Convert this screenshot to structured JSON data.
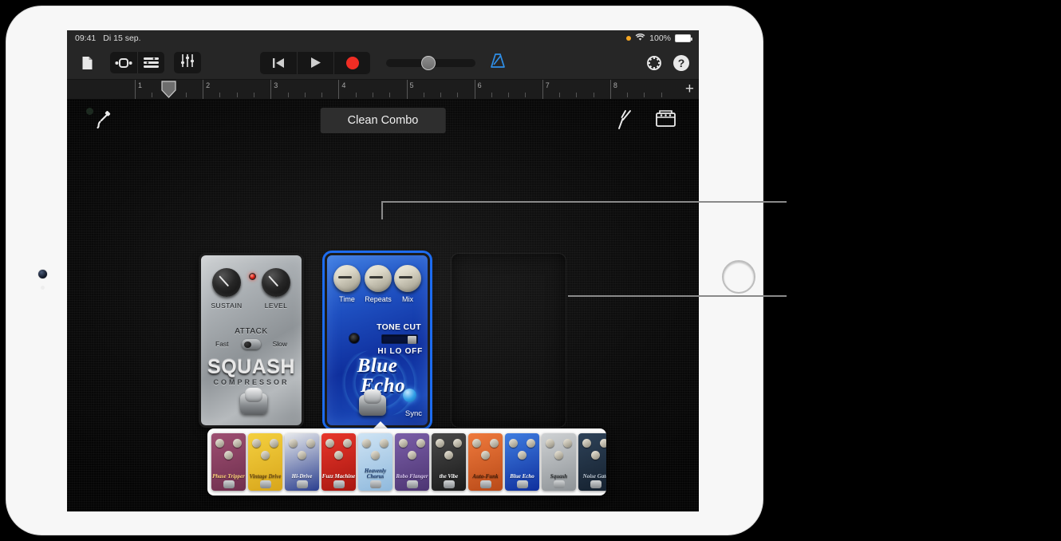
{
  "status_bar": {
    "time": "09:41",
    "date": "Di 15 sep.",
    "battery_percent": "100%",
    "wifi_icon": "wifi-icon",
    "orange_dot": "orange-recording-dot"
  },
  "toolbar": {
    "navigation_icon": "document-icon",
    "loop_browser_icon": "loop-browser-icon",
    "tracks_icon": "track-list-icon",
    "mixer_icon": "mixer-faders-icon",
    "rewind_icon": "rewind-to-start-icon",
    "play_icon": "play-icon",
    "record_icon": "record-icon",
    "master_volume_label": "master-volume-slider",
    "metronome_icon": "metronome-icon",
    "settings_icon": "gear-icon",
    "help_icon": "help-question-icon"
  },
  "ruler": {
    "bars": [
      "1",
      "2",
      "3",
      "4",
      "5",
      "6",
      "7",
      "8"
    ],
    "playhead_position": "1",
    "add_icon": "plus-icon"
  },
  "stage_header": {
    "input_icon": "guitar-cable-icon",
    "preset_name": "Clean Combo",
    "tuner_icon": "tuning-fork-icon",
    "amp_icon": "amplifier-icon"
  },
  "pedals": [
    {
      "id": "squash-compressor",
      "name": "SQUASH",
      "subtitle": "COMPRESSOR",
      "color": "#9da2a6",
      "controls": {
        "knobs": [
          "SUSTAIN",
          "LEVEL"
        ],
        "switch_title": "ATTACK",
        "switch_options": [
          "Fast",
          "Slow"
        ],
        "led": "status-led"
      }
    },
    {
      "id": "blue-echo",
      "name_line1": "Blue",
      "name_line2": "Echo",
      "color": "#1e4fc0",
      "selected": true,
      "controls": {
        "knobs": [
          "Time",
          "Repeats",
          "Mix"
        ],
        "switch_title": "TONE CUT",
        "switch_options": "HI LO OFF",
        "sync_label": "Sync"
      }
    },
    {
      "id": "empty-slot",
      "name": "",
      "empty": true
    }
  ],
  "browser": {
    "items": [
      {
        "name": "Phase Tripper",
        "c1": "#9e4f72",
        "c2": "#6f2f4e",
        "text": "#ffd37a"
      },
      {
        "name": "Vintage Drive",
        "c1": "#f4d03f",
        "c2": "#d8a61b",
        "text": "#6c4a12"
      },
      {
        "name": "Hi-Drive",
        "c1": "#e8eaec",
        "c2": "#2b3f8f",
        "text": "#ffffff"
      },
      {
        "name": "Fuzz Machine",
        "c1": "#e8362b",
        "c2": "#a81710",
        "text": "#ffffff"
      },
      {
        "name": "Heavenly Chorus",
        "c1": "#cfe4f4",
        "c2": "#8fb9dd",
        "text": "#1b3b6e"
      },
      {
        "name": "Robo Flanger",
        "c1": "#7b5fa8",
        "c2": "#4d3573",
        "text": "#d9c7f0"
      },
      {
        "name": "the Vibe",
        "c1": "#4a4a4a",
        "c2": "#1a1a1a",
        "text": "#ffffff"
      },
      {
        "name": "Auto-Funk",
        "c1": "#ef7a3d",
        "c2": "#b94a18",
        "text": "#4a1e08"
      },
      {
        "name": "Blue Echo",
        "c1": "#3f7de0",
        "c2": "#0f2f9d",
        "text": "#ffffff"
      },
      {
        "name": "Squash",
        "c1": "#cfd2d4",
        "c2": "#8e9397",
        "text": "#2b2e30"
      },
      {
        "name": "Noise Gate",
        "c1": "#2e4258",
        "c2": "#14202e",
        "text": "#c8d4e0"
      }
    ],
    "none_option_icon": "no-effect-icon",
    "pointer": "browser-arrow-pointer"
  },
  "callouts": [
    {
      "id": "callout-knob",
      "target": "repeats-knob"
    },
    {
      "id": "callout-slot",
      "target": "empty-pedal-slot"
    }
  ],
  "device": {
    "camera_icon": "front-camera",
    "home_button": "home-button"
  }
}
